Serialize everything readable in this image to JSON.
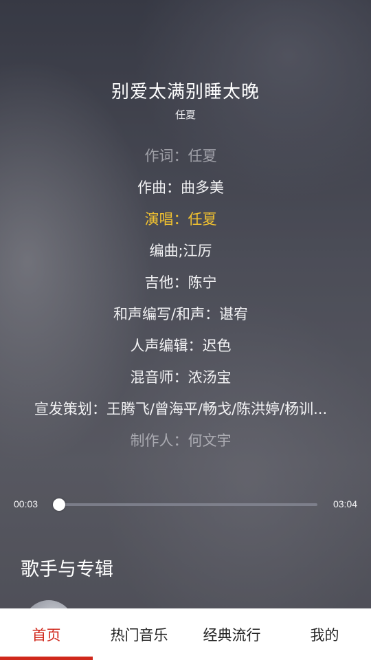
{
  "player": {
    "title": "别爱太满别睡太晚",
    "artist": "任夏",
    "lyrics": [
      {
        "text": "作词：任夏",
        "state": "dim"
      },
      {
        "text": "作曲：曲多美",
        "state": "normal"
      },
      {
        "text": "演唱：任夏",
        "state": "active"
      },
      {
        "text": "编曲;江厉",
        "state": "normal"
      },
      {
        "text": "吉他：陈宁",
        "state": "normal"
      },
      {
        "text": "和声编写/和声：谌宥",
        "state": "normal"
      },
      {
        "text": "人声编辑：迟色",
        "state": "normal"
      },
      {
        "text": "混音师：浓汤宝",
        "state": "normal"
      },
      {
        "text": "宣发策划：王腾飞/曾海平/畅戈/陈洪婷/杨训...",
        "state": "normal"
      },
      {
        "text": "制作人：何文宇",
        "state": "dim"
      }
    ],
    "current_time": "00:03",
    "total_time": "03:04",
    "progress": 0.016
  },
  "section": {
    "title": "歌手与专辑"
  },
  "nav": {
    "items": [
      {
        "label": "首页",
        "active": true
      },
      {
        "label": "热门音乐",
        "active": false
      },
      {
        "label": "经典流行",
        "active": false
      },
      {
        "label": "我的",
        "active": false
      }
    ]
  },
  "colors": {
    "accent": "#d0281c",
    "lyric_active": "#f2c230"
  }
}
